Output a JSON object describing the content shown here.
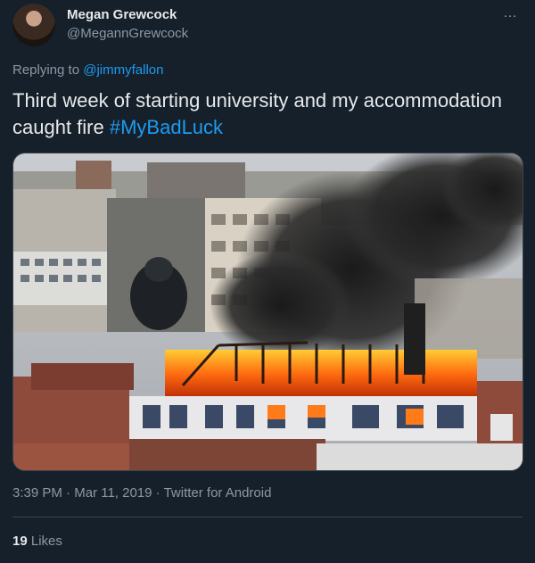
{
  "author": {
    "name": "Megan Grewcock",
    "handle": "@MegannGrewcock"
  },
  "more_icon": "…",
  "reply": {
    "prefix": "Replying to",
    "user": "@jimmyfallon"
  },
  "tweet": {
    "text": "Third week of starting university and my accommodation caught fire",
    "hashtag": "#MyBadLuck"
  },
  "meta": {
    "time": "3:39 PM",
    "sep1": " · ",
    "date": "Mar 11, 2019",
    "sep2": " · ",
    "source": "Twitter for Android"
  },
  "stats": {
    "likes_count": "19",
    "likes_label": "Likes"
  },
  "colors": {
    "background": "#15202b",
    "accent": "#1d9bf0",
    "secondary_text": "#8b98a5"
  }
}
